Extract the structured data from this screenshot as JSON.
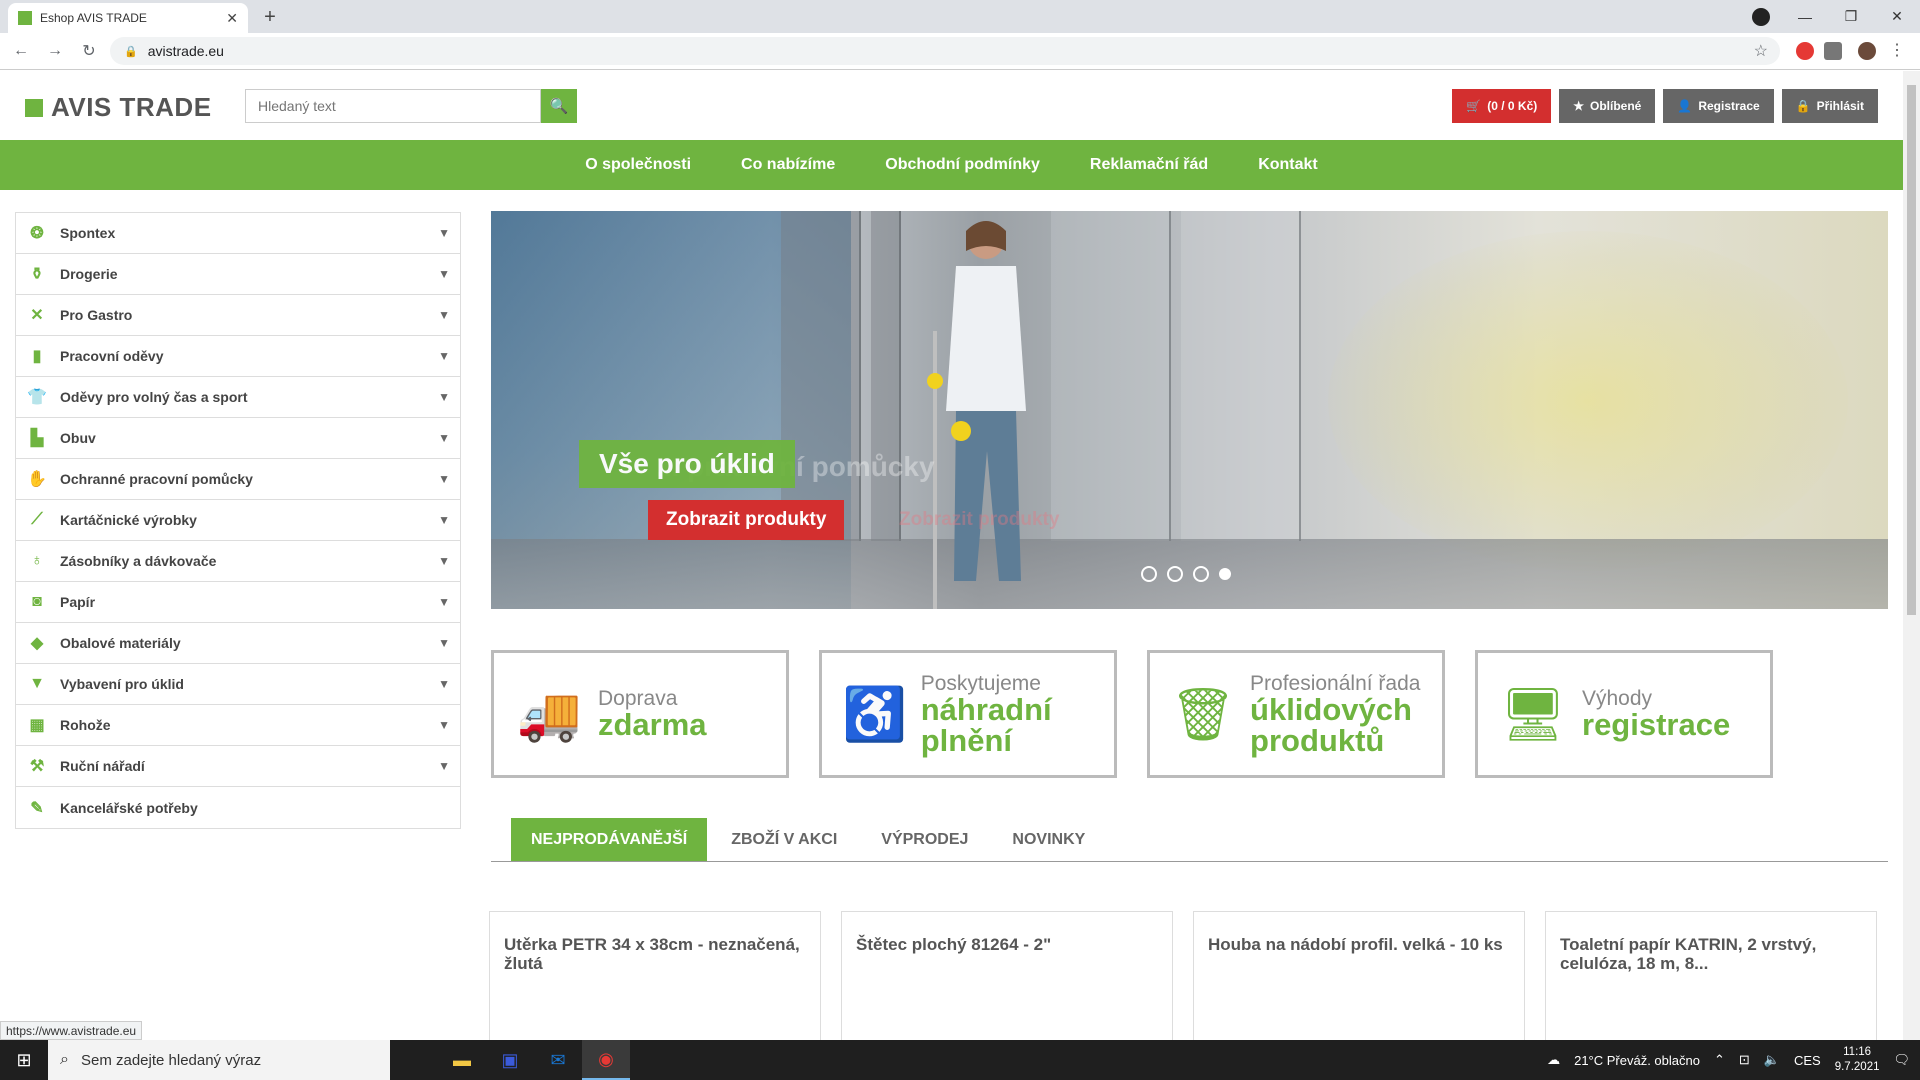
{
  "browser": {
    "tab_title": "Eshop AVIS TRADE",
    "url": "avistrade.eu",
    "status_url": "https://www.avistrade.eu"
  },
  "header": {
    "logo": "AVIS TRADE",
    "search_placeholder": "Hledaný text",
    "cart": "(0 / 0 Kč)",
    "favorites": "Oblíbené",
    "register": "Registrace",
    "login": "Přihlásit"
  },
  "nav": [
    "O společnosti",
    "Co nabízíme",
    "Obchodní podmínky",
    "Reklamační řád",
    "Kontakt"
  ],
  "categories": [
    {
      "label": "Spontex",
      "icon": "sponge-icon",
      "glyph": "❂"
    },
    {
      "label": "Drogerie",
      "icon": "bottle-icon",
      "glyph": "⚱"
    },
    {
      "label": "Pro Gastro",
      "icon": "cutlery-icon",
      "glyph": "✕"
    },
    {
      "label": "Pracovní oděvy",
      "icon": "workwear-icon",
      "glyph": "▮"
    },
    {
      "label": "Oděvy pro volný čas a sport",
      "icon": "tshirt-icon",
      "glyph": "👕"
    },
    {
      "label": "Obuv",
      "icon": "boot-icon",
      "glyph": "▙"
    },
    {
      "label": "Ochranné pracovní pomůcky",
      "icon": "gloves-icon",
      "glyph": "✋"
    },
    {
      "label": "Kartáčnické výrobky",
      "icon": "brush-icon",
      "glyph": "⟋"
    },
    {
      "label": "Zásobníky a dávkovače",
      "icon": "dispenser-icon",
      "glyph": "♁"
    },
    {
      "label": "Papír",
      "icon": "paper-roll-icon",
      "glyph": "◙"
    },
    {
      "label": "Obalové materiály",
      "icon": "box-icon",
      "glyph": "◆"
    },
    {
      "label": "Vybavení pro úklid",
      "icon": "bucket-icon",
      "glyph": "▼"
    },
    {
      "label": "Rohože",
      "icon": "mat-icon",
      "glyph": "▦"
    },
    {
      "label": "Ruční nářadí",
      "icon": "tool-icon",
      "glyph": "⚒"
    },
    {
      "label": "Kancelářské potřeby",
      "icon": "paperclip-icon",
      "glyph": "✎"
    }
  ],
  "banner": {
    "title": "Vše pro úklid",
    "button": "Zobrazit produkty",
    "ghost_title": "... pracovní pomůcky",
    "ghost_button": "Zobrazit produkty"
  },
  "features": [
    {
      "small": "Doprava",
      "big": "zdarma",
      "icon": "truck-icon",
      "glyph": "🚚"
    },
    {
      "small": "Poskytujeme",
      "big": "náhradní plnění",
      "icon": "wheelchair-icon",
      "glyph": "♿"
    },
    {
      "small": "Profesionální řada",
      "big": "úklidových produktů",
      "icon": "cleaning-bucket-icon",
      "glyph": "🗑"
    },
    {
      "small": "Výhody",
      "big": "registrace",
      "icon": "monitor-icon",
      "glyph": "🖥"
    }
  ],
  "product_tabs": [
    "NEJPRODÁVANĚJŠÍ",
    "ZBOŽÍ V AKCI",
    "VÝPRODEJ",
    "NOVINKY"
  ],
  "products": [
    "Utěrka PETR 34 x 38cm - neznačená, žlutá",
    "Štětec plochý 81264 - 2\"",
    "Houba na nádobí profil. velká - 10 ks",
    "Toaletní papír KATRIN, 2 vrstvý, celulóza, 18 m, 8..."
  ],
  "taskbar": {
    "search": "Sem zadejte hledaný výraz",
    "weather": "21°C  Převáž. oblačno",
    "lang": "CES",
    "time": "11:16",
    "date": "9.7.2021"
  },
  "colors": {
    "brand_green": "#6fb440",
    "red": "#d32f2f"
  }
}
